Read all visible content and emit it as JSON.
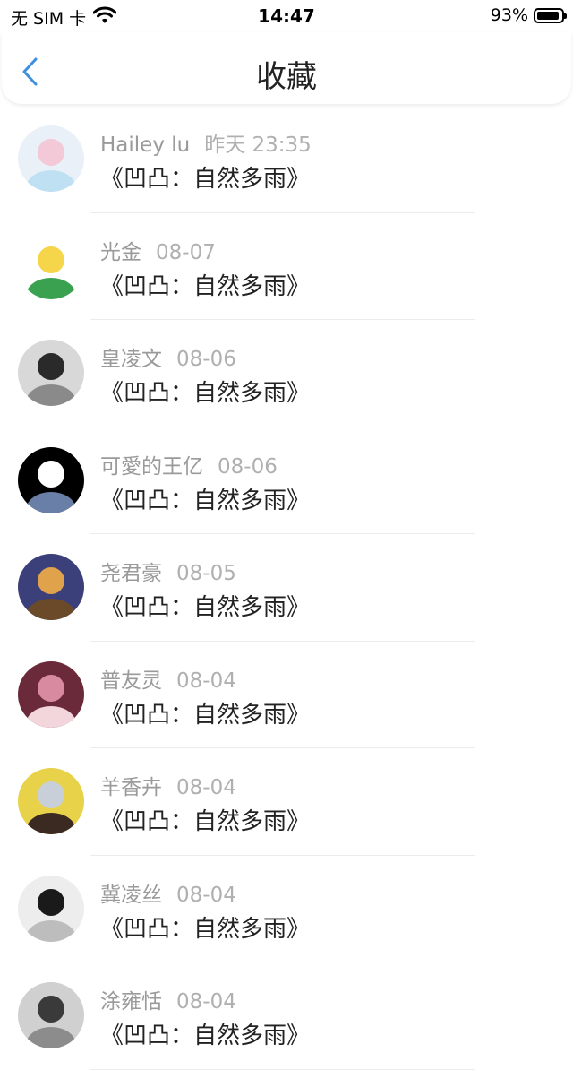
{
  "status_bar": {
    "carrier": "无 SIM 卡",
    "time": "14:47",
    "battery_percent": "93%",
    "battery_level": 0.93
  },
  "nav": {
    "title": "收藏",
    "back_icon": "chevron-left-icon",
    "accent_color": "#3d8fe0"
  },
  "favorites": [
    {
      "user": "Hailey lu",
      "date": "昨天 23:35",
      "title": "《凹凸：自然多雨》",
      "avatar_colors": [
        "#e9f0f7",
        "#f3c9d8",
        "#bfe0f2"
      ]
    },
    {
      "user": "光金",
      "date": "08-07",
      "title": "《凹凸：自然多雨》",
      "avatar_colors": [
        "#ffffff",
        "#f5d54a",
        "#3aa150"
      ]
    },
    {
      "user": "皇凌文",
      "date": "08-06",
      "title": "《凹凸：自然多雨》",
      "avatar_colors": [
        "#d8d8d8",
        "#2a2a2a",
        "#8a8a8a"
      ]
    },
    {
      "user": "可愛的王亿",
      "date": "08-06",
      "title": "《凹凸：自然多雨》",
      "avatar_colors": [
        "#000000",
        "#ffffff",
        "#6a7fa8"
      ]
    },
    {
      "user": "尧君豪",
      "date": "08-05",
      "title": "《凹凸：自然多雨》",
      "avatar_colors": [
        "#3b3f7a",
        "#e0a24a",
        "#6b4a2a"
      ]
    },
    {
      "user": "普友灵",
      "date": "08-04",
      "title": "《凹凸：自然多雨》",
      "avatar_colors": [
        "#6a2a3a",
        "#d88aa0",
        "#f2d6dc"
      ]
    },
    {
      "user": "羊香卉",
      "date": "08-04",
      "title": "《凹凸：自然多雨》",
      "avatar_colors": [
        "#e8d24a",
        "#c9cfd8",
        "#3a2a22"
      ]
    },
    {
      "user": "冀凌丝",
      "date": "08-04",
      "title": "《凹凸：自然多雨》",
      "avatar_colors": [
        "#ededed",
        "#1a1a1a",
        "#bdbdbd"
      ]
    },
    {
      "user": "涂雍恬",
      "date": "08-04",
      "title": "《凹凸：自然多雨》",
      "avatar_colors": [
        "#d0d0d0",
        "#3a3a3a",
        "#8c8c8c"
      ]
    }
  ]
}
